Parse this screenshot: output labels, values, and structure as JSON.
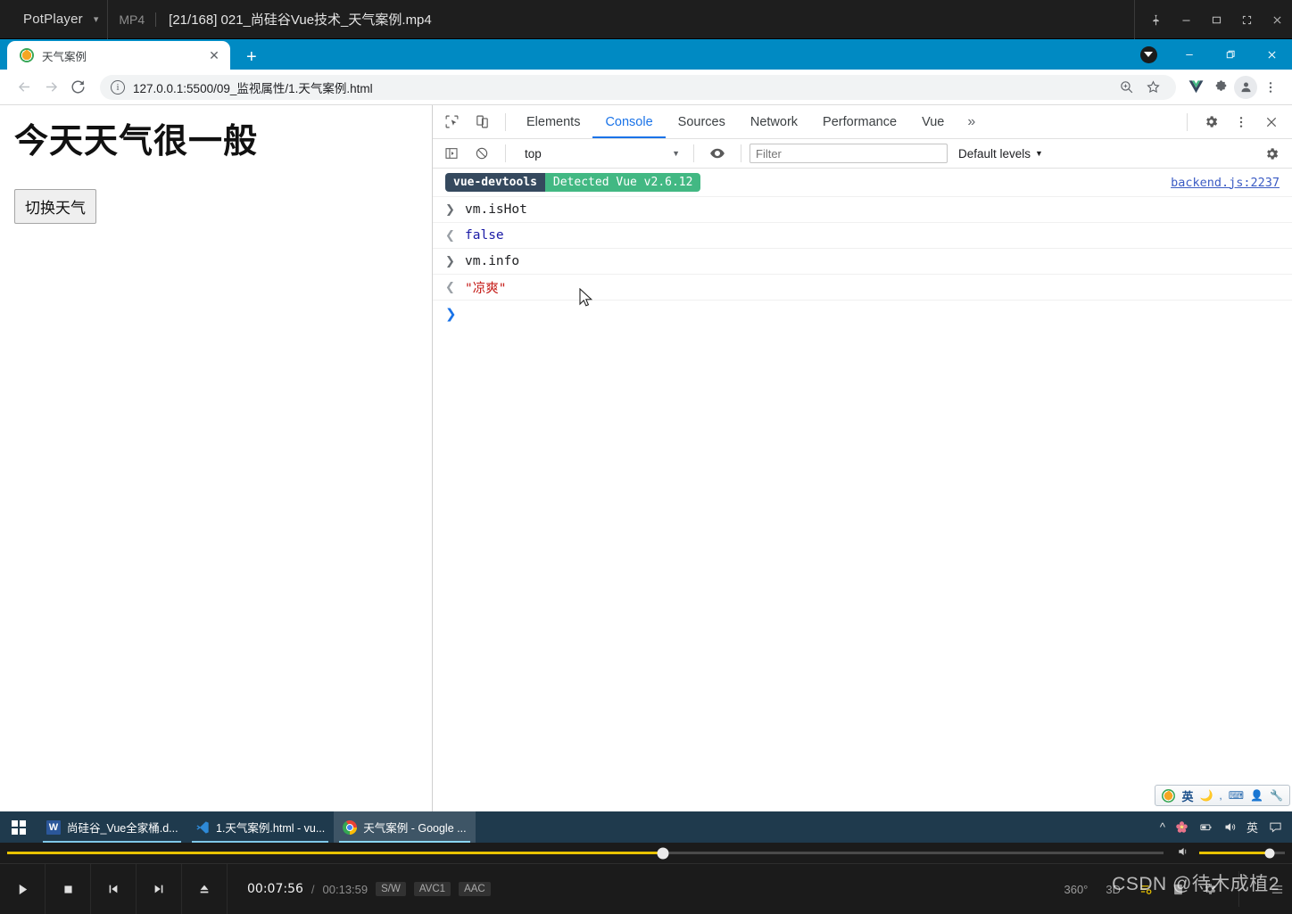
{
  "potplayer": {
    "app_name": "PotPlayer",
    "format_label": "MP4",
    "file_title": "[21/168] 021_尚硅谷Vue技术_天气案例.mp4",
    "window_controls": [
      "pin",
      "minimize",
      "maximize",
      "fullscreen",
      "close"
    ],
    "transport": {
      "play": "play",
      "stop": "stop",
      "previous": "previous",
      "next": "next",
      "eject": "eject"
    },
    "time_current": "00:07:56",
    "time_separator": "/",
    "time_total": "00:13:59",
    "chips": [
      "S/W",
      "AVC1",
      "AAC"
    ],
    "right_buttons": [
      "360°",
      "3D",
      "playlist",
      "info",
      "settings",
      "menu"
    ],
    "progress_percent": 56.7,
    "volume_percent": 82,
    "accent_color": "#e8c200"
  },
  "chrome": {
    "tab": {
      "title": "天气案例",
      "favicon": "vue-favicon",
      "close_label": "✕"
    },
    "new_tab_label": "+",
    "window_controls": {
      "download": "download",
      "minimize": "—",
      "restore": "❐",
      "close": "✕"
    },
    "toolbar": {
      "back": "←",
      "forward": "→",
      "reload": "⟳",
      "url": "127.0.0.1:5500/09_监视属性/1.天气案例.html",
      "zoom_icon": "zoom-icon",
      "bookmark_icon": "star-icon",
      "vue_extension": "vue-devtools-extension",
      "puzzle_icon": "extensions-icon",
      "profile_icon": "profile-avatar",
      "menu_icon": "three-dot-menu"
    },
    "titlebar_color": "#008ac3"
  },
  "page": {
    "heading": "今天天气很一般",
    "button_label": "切换天气"
  },
  "devtools": {
    "tabs": [
      {
        "label": "Elements",
        "active": false
      },
      {
        "label": "Console",
        "active": true
      },
      {
        "label": "Sources",
        "active": false
      },
      {
        "label": "Network",
        "active": false
      },
      {
        "label": "Performance",
        "active": false
      },
      {
        "label": "Vue",
        "active": false
      }
    ],
    "overflow_label": "»",
    "inspect_icon": "inspect-cursor-icon",
    "device_icon": "device-toolbar-icon",
    "settings_icon": "gear-icon",
    "kebab_icon": "three-dot-menu-icon",
    "close_icon": "close-icon",
    "console_toolbar": {
      "sidebar_icon": "console-sidebar-icon",
      "clear_icon": "clear-console-icon",
      "context": "top",
      "context_caret": "▼",
      "live_expression_icon": "eye-icon",
      "filter_placeholder": "Filter",
      "filter_value": "",
      "levels_label": "Default levels",
      "levels_caret": "▼",
      "console_settings_icon": "gear-icon"
    },
    "messages": [
      {
        "type": "banner",
        "badge_left": "vue-devtools",
        "badge_right": "Detected Vue v2.6.12",
        "source": "backend.js:2237",
        "badge_left_color": "#35495e",
        "badge_right_color": "#42b883"
      },
      {
        "type": "input",
        "arrow": "❯",
        "text": "vm.isHot"
      },
      {
        "type": "output",
        "arrow": "❮",
        "text": "false",
        "color": "#1a1aa6"
      },
      {
        "type": "input",
        "arrow": "❯",
        "text": "vm.info"
      },
      {
        "type": "output",
        "arrow": "❮",
        "text": "\"凉爽\"",
        "color": "#c41a16"
      }
    ],
    "prompt_chevron": "❯"
  },
  "ime": {
    "logo": "sogou-logo",
    "mode": "英",
    "moon_icon": "moon-icon",
    "punct_icon": "punctuation-icon",
    "keyboard_icon": "keyboard-icon",
    "user_icon": "user-icon",
    "tools_icon": "wrench-icon"
  },
  "taskbar": {
    "start_label": "start-button",
    "items": [
      {
        "label": "尚硅谷_Vue全家桶.d...",
        "icon": "word-icon",
        "active": false
      },
      {
        "label": "1.天气案例.html - vu...",
        "icon": "vscode-icon",
        "active": false
      },
      {
        "label": "天气案例 - Google ...",
        "icon": "chrome-icon",
        "active": true
      }
    ],
    "tray": [
      "^",
      "flower-icon",
      "battery-icon",
      "volume-icon",
      "英",
      "notification-icon"
    ]
  },
  "watermark": "CSDN @待木成植2"
}
